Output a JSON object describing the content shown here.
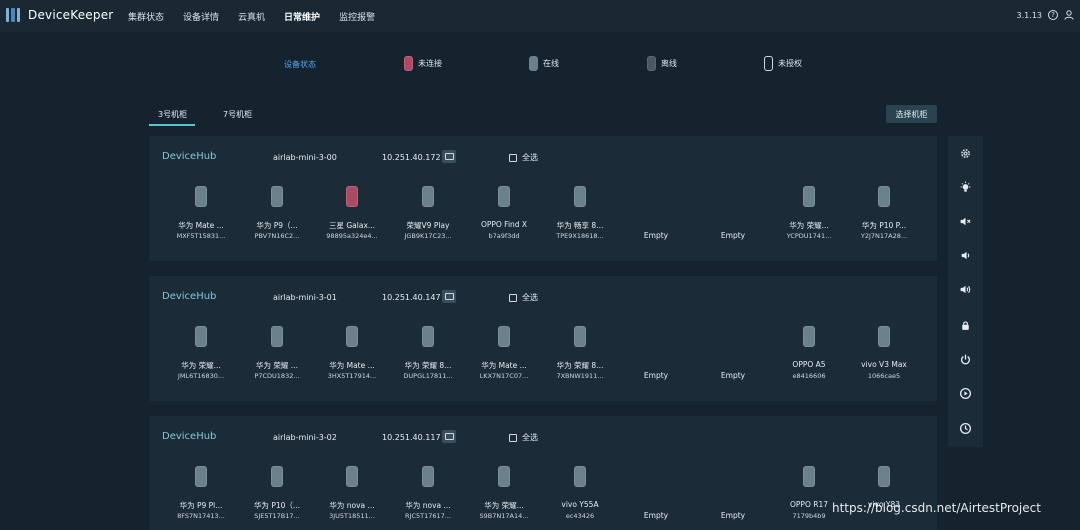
{
  "app": {
    "brand": "DeviceKeeper",
    "version": "3.1.13"
  },
  "nav": [
    {
      "label": "集群状态"
    },
    {
      "label": "设备详情"
    },
    {
      "label": "云真机"
    },
    {
      "label": "日常维护",
      "active": true
    },
    {
      "label": "监控报警"
    }
  ],
  "legend": {
    "title": "设备状态",
    "items": [
      {
        "label": "未连接",
        "color": "#a84b63"
      },
      {
        "label": "在线",
        "color": "#6b8189"
      },
      {
        "label": "离线",
        "color": "#4d5760"
      },
      {
        "label": "未授权",
        "color": "#15232f"
      }
    ]
  },
  "tabs": [
    {
      "label": "3号机柜",
      "active": true
    },
    {
      "label": "7号机柜"
    }
  ],
  "select_cabinet_label": "选择机柜",
  "select_all_label": "全选",
  "hubs": [
    {
      "title": "DeviceHub",
      "name": "airlab-mini-3-00",
      "ip": "10.251.40.172",
      "devices": [
        {
          "name": "华为 Mate ...",
          "serial": "MXF5T15831...",
          "status": "online"
        },
        {
          "name": "华为 P9（...",
          "serial": "PBV7N16C2...",
          "status": "online"
        },
        {
          "name": "三星 Galax...",
          "serial": "98895a324e4...",
          "status": "unconnected"
        },
        {
          "name": "荣耀V9 Play",
          "serial": "JGB9K17C23...",
          "status": "online"
        },
        {
          "name": "OPPO Find X",
          "serial": "b7a9f3dd",
          "status": "online"
        },
        {
          "name": "华为 畅享 8...",
          "serial": "TPE9X18618...",
          "status": "online"
        },
        {
          "empty": "Empty"
        },
        {
          "empty": "Empty"
        },
        {
          "name": "华为 荣耀...",
          "serial": "YCPDU1741...",
          "status": "online"
        },
        {
          "name": "华为 P10 P...",
          "serial": "Y2J7N17A28...",
          "status": "online"
        }
      ]
    },
    {
      "title": "DeviceHub",
      "name": "airlab-mini-3-01",
      "ip": "10.251.40.147",
      "devices": [
        {
          "name": "华为 荣耀...",
          "serial": "JML6T16830...",
          "status": "online"
        },
        {
          "name": "华为 荣耀 ...",
          "serial": "P7CDU1832...",
          "status": "online"
        },
        {
          "name": "华为 Mate ...",
          "serial": "3HX5T17914...",
          "status": "online"
        },
        {
          "name": "华为 荣耀 8...",
          "serial": "DUPGL17811...",
          "status": "online"
        },
        {
          "name": "华为 Mate ...",
          "serial": "LKX7N17C07...",
          "status": "online"
        },
        {
          "name": "华为 荣耀 8...",
          "serial": "7XBNW1911...",
          "status": "online"
        },
        {
          "empty": "Empty"
        },
        {
          "empty": "Empty"
        },
        {
          "name": "OPPO A5",
          "serial": "e8416606",
          "status": "online"
        },
        {
          "name": "vivo V3 Max",
          "serial": "1066cae5",
          "status": "online"
        }
      ]
    },
    {
      "title": "DeviceHub",
      "name": "airlab-mini-3-02",
      "ip": "10.251.40.117",
      "devices": [
        {
          "name": "华为 P9 Pl...",
          "serial": "8FS7N17413...",
          "status": "online"
        },
        {
          "name": "华为 P10（...",
          "serial": "SJE5T17B17...",
          "status": "online"
        },
        {
          "name": "华为 nova ...",
          "serial": "3JU5T18511...",
          "status": "online"
        },
        {
          "name": "华为 nova ...",
          "serial": "RJC5T17617...",
          "status": "online"
        },
        {
          "name": "华为 荣耀...",
          "serial": "S9B7N17A14...",
          "status": "online"
        },
        {
          "name": "vivo Y55A",
          "serial": "ec43426",
          "status": "online"
        },
        {
          "empty": "Empty"
        },
        {
          "empty": "Empty"
        },
        {
          "name": "OPPO R17",
          "serial": "7179b4b9",
          "status": "online"
        },
        {
          "name": "vivo Y83",
          "serial": "",
          "status": "online"
        }
      ]
    }
  ],
  "toolbar_icons": [
    "gear-icon",
    "bulb-icon",
    "volume-mute-icon",
    "volume-down-icon",
    "volume-up-icon",
    "lock-icon",
    "power-icon",
    "play-icon",
    "clock-icon"
  ],
  "watermark": "https://blog.csdn.net/AirtestProject"
}
